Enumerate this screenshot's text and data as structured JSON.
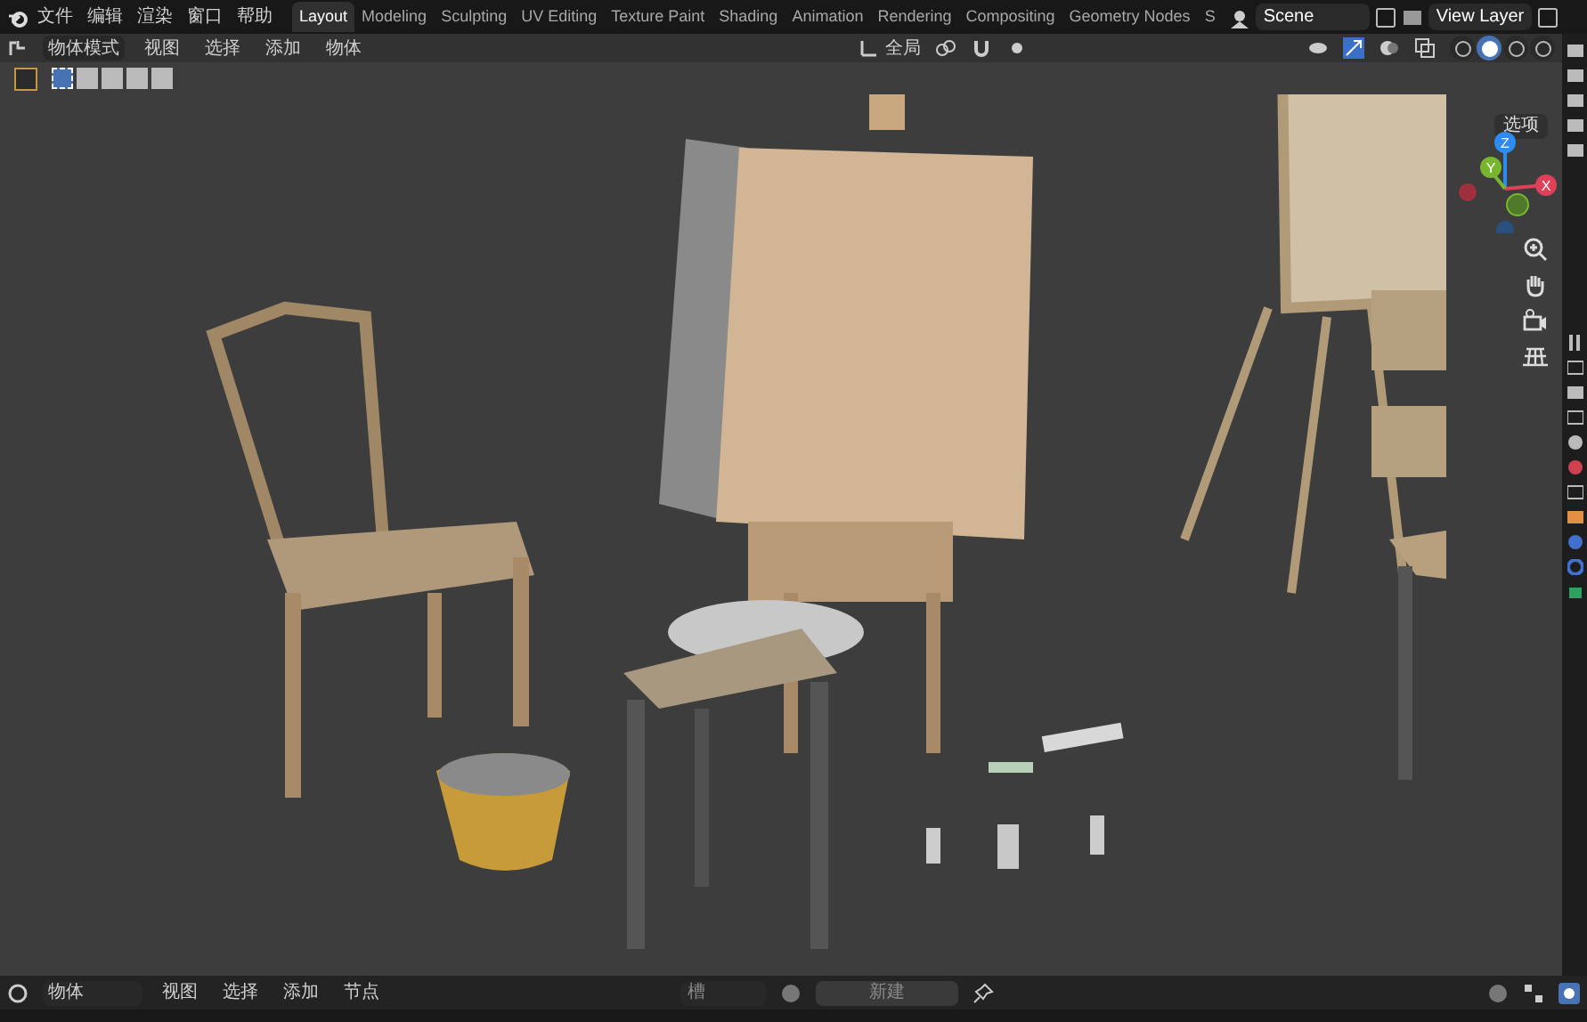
{
  "menu": [
    "文件",
    "编辑",
    "渲染",
    "窗口",
    "帮助"
  ],
  "workspace_tabs": [
    {
      "label": "Layout",
      "selected": true
    },
    {
      "label": "Modeling",
      "selected": false
    },
    {
      "label": "Sculpting",
      "selected": false
    },
    {
      "label": "UV Editing",
      "selected": false
    },
    {
      "label": "Texture Paint",
      "selected": false
    },
    {
      "label": "Shading",
      "selected": false
    },
    {
      "label": "Animation",
      "selected": false
    },
    {
      "label": "Rendering",
      "selected": false
    },
    {
      "label": "Compositing",
      "selected": false
    },
    {
      "label": "Geometry Nodes",
      "selected": false
    },
    {
      "label": "S",
      "selected": false
    }
  ],
  "scene": {
    "name": "Scene"
  },
  "view_layer": {
    "name": "View Layer"
  },
  "viewport_header": {
    "mode": "物体模式",
    "menus": [
      "视图",
      "选择",
      "添加",
      "物体"
    ],
    "orientation": "全局",
    "options": "选项"
  },
  "select_modes": [
    {
      "selected": true
    },
    {
      "selected": false
    },
    {
      "selected": false
    },
    {
      "selected": false
    },
    {
      "selected": false
    }
  ],
  "shading_modes": [
    {
      "selected": false
    },
    {
      "selected": true
    },
    {
      "selected": false
    },
    {
      "selected": false
    }
  ],
  "gizmo": {
    "axes": [
      "Z",
      "Y",
      "X"
    ]
  },
  "editor_header": {
    "mode": "物体",
    "menus": [
      "视图",
      "选择",
      "添加",
      "节点"
    ],
    "slot": "槽",
    "new_button": "新建"
  }
}
